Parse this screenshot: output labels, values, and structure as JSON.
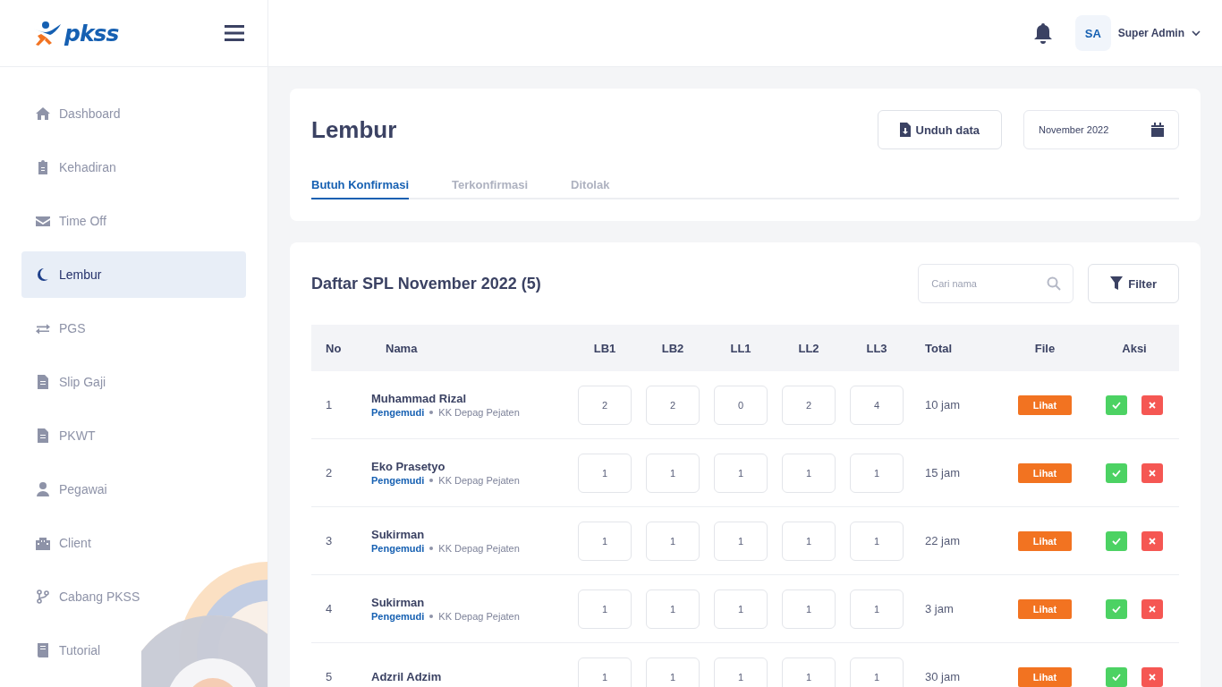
{
  "header": {
    "logo": "pkss",
    "user": {
      "initials": "SA",
      "name": "Super Admin"
    }
  },
  "sidebar": {
    "items": [
      {
        "label": "Dashboard",
        "selected": false
      },
      {
        "label": "Kehadiran",
        "selected": false
      },
      {
        "label": "Time Off",
        "selected": false
      },
      {
        "label": "Lembur",
        "selected": true
      },
      {
        "label": "PGS",
        "selected": false
      },
      {
        "label": "Slip Gaji",
        "selected": false
      },
      {
        "label": "PKWT",
        "selected": false
      },
      {
        "label": "Pegawai",
        "selected": false
      },
      {
        "label": "Client",
        "selected": false
      },
      {
        "label": "Cabang PKSS",
        "selected": false
      },
      {
        "label": "Tutorial",
        "selected": false
      }
    ]
  },
  "page": {
    "title": "Lembur",
    "download_button": "Unduh data",
    "month_field": "November 2022",
    "tabs": [
      {
        "label": "Butuh Konfirmasi",
        "selected": true
      },
      {
        "label": "Terkonfirmasi",
        "selected": false
      },
      {
        "label": "Ditolak",
        "selected": false
      }
    ]
  },
  "list": {
    "title": "Daftar SPL November 2022 (5)",
    "search": {
      "placeholder": "Cari nama"
    },
    "filter_button": "Filter",
    "columns": [
      "No",
      "Nama",
      "LB1",
      "LB2",
      "LL1",
      "LL2",
      "LL3",
      "Total",
      "File",
      "Aksi"
    ],
    "rows": [
      {
        "no": "1",
        "name": "Muhammad Rizal",
        "role": "Pengemudi",
        "location": "KK Depag Pejaten",
        "hours": [
          "2",
          "2",
          "0",
          "2",
          "4"
        ],
        "total": "10 jam",
        "file": "Lihat"
      },
      {
        "no": "2",
        "name": "Eko Prasetyo",
        "role": "Pengemudi",
        "location": "KK Depag Pejaten",
        "hours": [
          "1",
          "1",
          "1",
          "1",
          "1"
        ],
        "total": "15 jam",
        "file": "Lihat"
      },
      {
        "no": "3",
        "name": "Sukirman",
        "role": "Pengemudi",
        "location": "KK Depag Pejaten",
        "hours": [
          "1",
          "1",
          "1",
          "1",
          "1"
        ],
        "total": "22 jam",
        "file": "Lihat"
      },
      {
        "no": "4",
        "name": "Sukirman",
        "role": "Pengemudi",
        "location": "KK Depag Pejaten",
        "hours": [
          "1",
          "1",
          "1",
          "1",
          "1"
        ],
        "total": "3 jam",
        "file": "Lihat"
      },
      {
        "no": "5",
        "name": "Adzril Adzim",
        "hours": [
          "1",
          "1",
          "1",
          "1",
          "1"
        ],
        "total": "30 jam",
        "file": "Lihat"
      }
    ]
  }
}
